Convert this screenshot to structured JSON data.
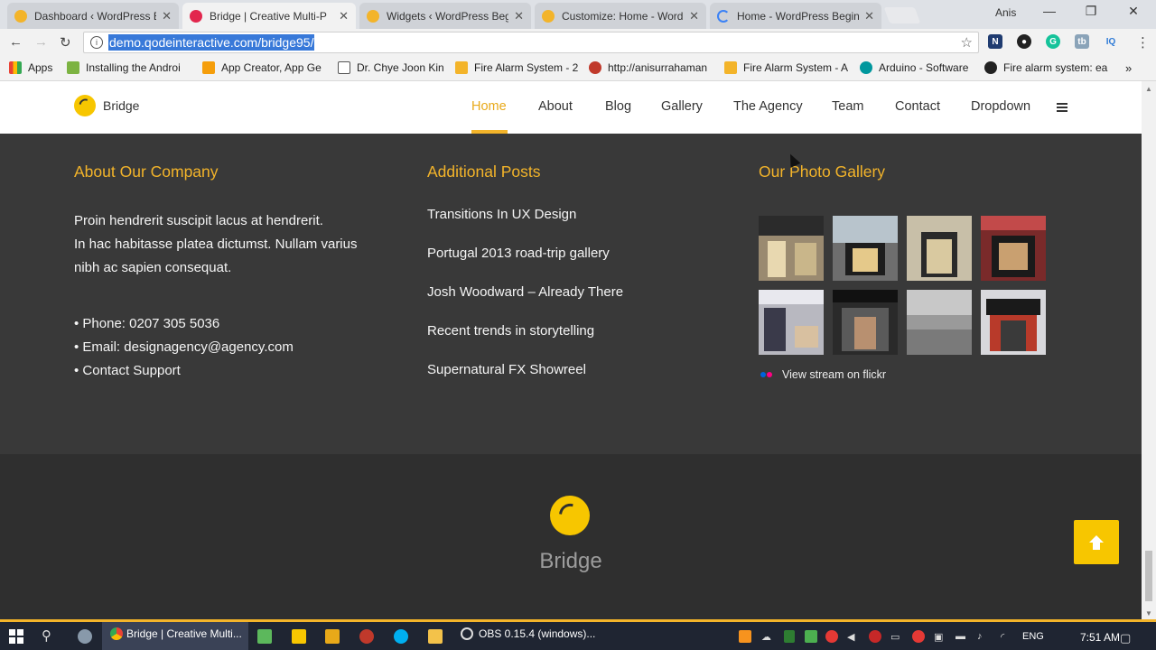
{
  "browser": {
    "tabs": [
      {
        "title": "Dashboard ‹ WordPress B",
        "favicon_color": "#f3b42a"
      },
      {
        "title": "Bridge | Creative Multi-P",
        "favicon_color": "#e2264d",
        "active": true
      },
      {
        "title": "Widgets ‹ WordPress Beg",
        "favicon_color": "#f3b42a"
      },
      {
        "title": "Customize: Home - Word",
        "favicon_color": "#f3b42a"
      },
      {
        "title": "Home - WordPress Begin",
        "favicon_color": "#3b82f6"
      }
    ],
    "user": "Anis",
    "url": "demo.qodeinteractive.com/bridge95/",
    "bookmarks": [
      {
        "label": "Apps",
        "color": "#e94235"
      },
      {
        "label": "Installing the Androi",
        "color": "#7cb342"
      },
      {
        "label": "App Creator, App Ge",
        "color": "#f59e0b"
      },
      {
        "label": "Dr. Chye Joon Kin",
        "color": "#ffffff"
      },
      {
        "label": "Fire Alarm System - 2",
        "color": "#f3b42a"
      },
      {
        "label": "http://anisurrahaman",
        "color": "#c0392b"
      },
      {
        "label": "Fire Alarm System - A",
        "color": "#f3b42a"
      },
      {
        "label": "Arduino - Software",
        "color": "#00979d"
      },
      {
        "label": "Fire alarm system: ea",
        "color": "#222222"
      }
    ]
  },
  "site": {
    "logo_text": "Bridge",
    "menu": [
      "Home",
      "About",
      "Blog",
      "Gallery",
      "The Agency",
      "Team",
      "Contact",
      "Dropdown"
    ],
    "about": {
      "title": "About Our Company",
      "line1": "Proin hendrerit suscipit lacus at hendrerit.",
      "line2": "In hac habitasse platea dictumst. Nullam varius",
      "line3": "nibh ac sapien consequat.",
      "phone": "• Phone: 0207 305 5036",
      "email": "• Email: designagency@agency.com",
      "support": "• Contact Support"
    },
    "posts": {
      "title": "Additional Posts",
      "items": [
        "Transitions In UX Design",
        "Portugal 2013 road-trip gallery",
        "Josh Woodward – Already There",
        "Recent trends in storytelling",
        "Supernatural FX Showreel"
      ]
    },
    "gallery": {
      "title": "Our Photo Gallery",
      "flickr": "View stream on flickr"
    },
    "footer_title": "Bridge"
  },
  "taskbar": {
    "items": [
      "Bridge | Creative Multi...",
      "OBS 0.15.4 (windows)..."
    ],
    "lang": "ENG",
    "time": "7:51 AM"
  }
}
